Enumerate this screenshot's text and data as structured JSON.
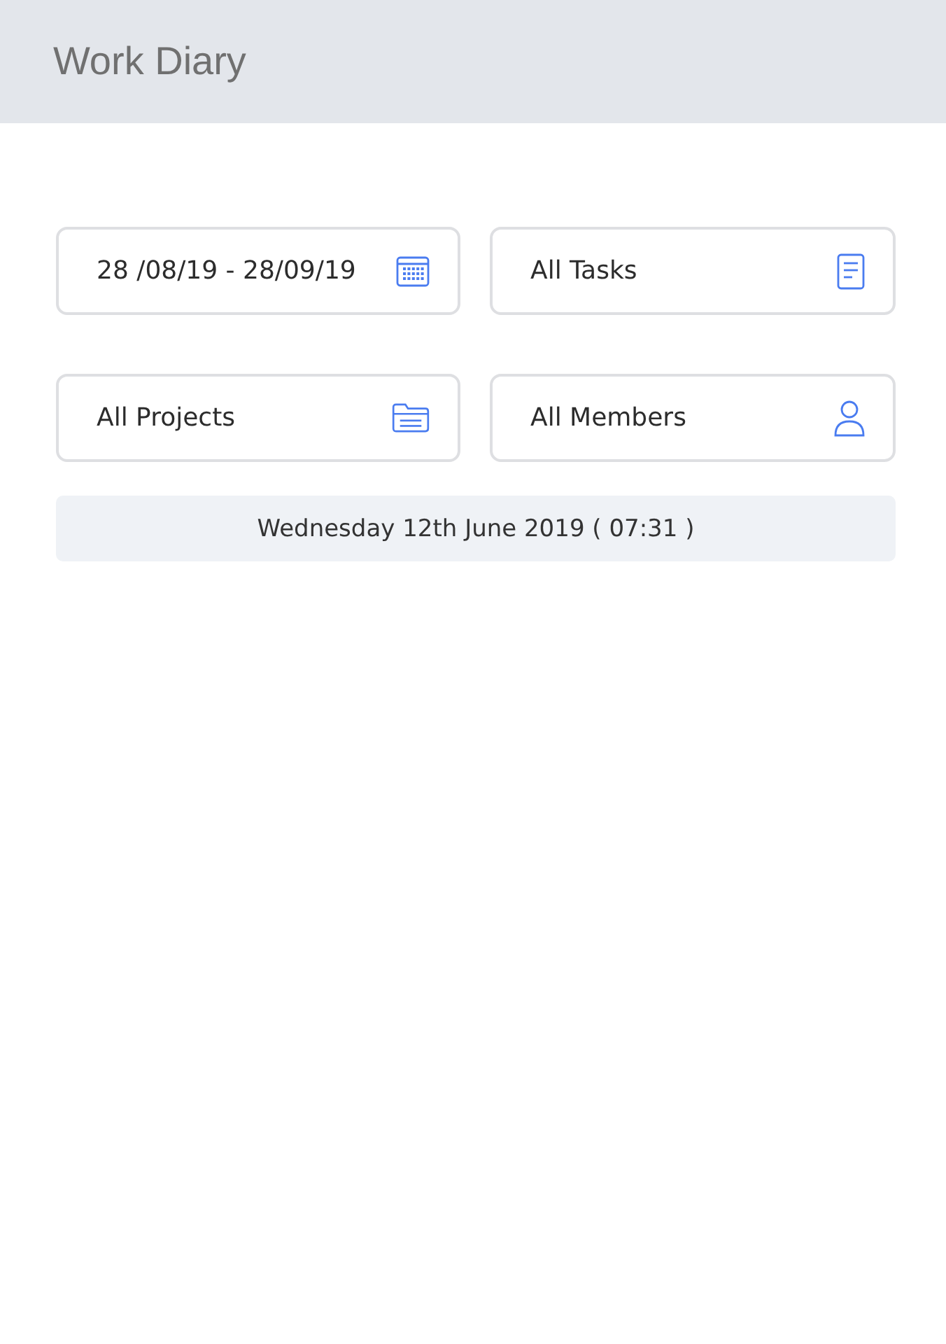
{
  "header": {
    "title": "Work Diary"
  },
  "filters": [
    {
      "kind": "calendar",
      "label": "28 /08/19 - 28/09/19"
    },
    {
      "kind": "document",
      "label": "All Tasks"
    },
    {
      "kind": "folder",
      "label": "All Projects"
    },
    {
      "kind": "person",
      "label": "All Members"
    }
  ],
  "date_bar": {
    "text": "Wednesday 12th June 2019 ( 07:31 )"
  }
}
